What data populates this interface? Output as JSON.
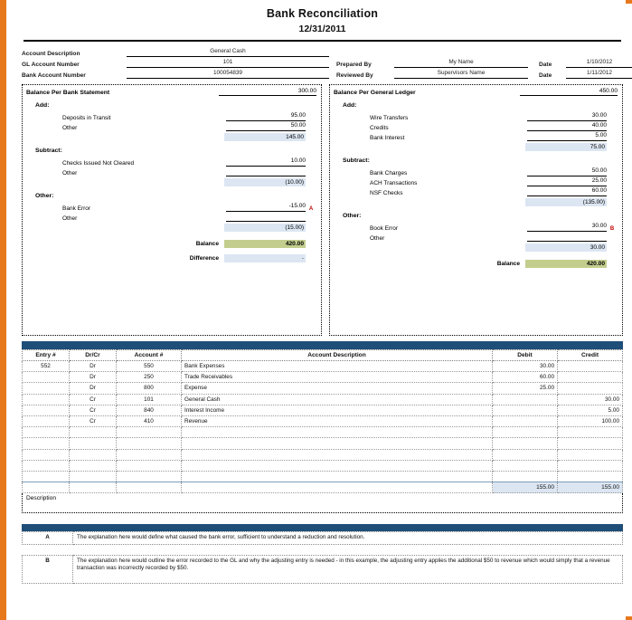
{
  "document": {
    "title": "Bank Reconciliation",
    "date": "12/31/2011"
  },
  "header": {
    "account_description_label": "Account Description",
    "account_description_value": "General Cash",
    "gl_account_number_label": "GL Account Number",
    "gl_account_number_value": "101",
    "bank_account_number_label": "Bank Account Number",
    "bank_account_number_value": "100054839",
    "prepared_by_label": "Prepared By",
    "prepared_by_value": "My Name",
    "prepared_date_label": "Date",
    "prepared_date_value": "1/10/2012",
    "reviewed_by_label": "Reviewed By",
    "reviewed_by_value": "Supervisors Name",
    "reviewed_date_label": "Date",
    "reviewed_date_value": "1/11/2012"
  },
  "bank_panel": {
    "heading": "Balance Per Bank Statement",
    "heading_value": "300.00",
    "add_label": "Add:",
    "add_items": [
      {
        "label": "Deposits in Transit",
        "value": "95.00"
      },
      {
        "label": "Other",
        "value": ""
      }
    ],
    "add_other_value": "50.00",
    "add_subtotal": "145.00",
    "subtract_label": "Subtract:",
    "subtract_items": [
      {
        "label": "Checks Issued Not Cleared",
        "value": "10.00"
      },
      {
        "label": "Other",
        "value": ""
      }
    ],
    "subtract_subtotal": "(10.00)",
    "other_label": "Other:",
    "other_items": [
      {
        "label": "Bank Error",
        "value": "-15.00",
        "mark": "A"
      },
      {
        "label": "Other",
        "value": "",
        "mark": ""
      }
    ],
    "other_subtotal": "(15.00)",
    "balance_label": "Balance",
    "balance_value": "420.00",
    "difference_label": "Difference",
    "difference_value": "-"
  },
  "ledger_panel": {
    "heading": "Balance Per General Ledger",
    "heading_value": "450.00",
    "add_label": "Add:",
    "add_items": [
      {
        "label": "Wire Transfers",
        "value": "30.00"
      },
      {
        "label": "Credits",
        "value": "40.00"
      },
      {
        "label": "Bank Interest",
        "value": "5.00"
      }
    ],
    "add_subtotal": "75.00",
    "subtract_label": "Subtract:",
    "subtract_items": [
      {
        "label": "Bank Charges",
        "value": "50.00"
      },
      {
        "label": "ACH Transactions",
        "value": "25.00"
      },
      {
        "label": "NSF Checks",
        "value": "60.00"
      }
    ],
    "subtract_subtotal": "(135.00)",
    "other_label": "Other:",
    "other_items": [
      {
        "label": "Book Error",
        "value": "30.00",
        "mark": "B"
      },
      {
        "label": "Other",
        "value": "",
        "mark": ""
      }
    ],
    "other_subtotal": "30.00",
    "balance_label": "Balance",
    "balance_value": "420.00"
  },
  "journal": {
    "columns": [
      "Entry #",
      "Dr/Cr",
      "Account #",
      "Account Description",
      "Debit",
      "Credit"
    ],
    "rows": [
      {
        "entry": "552",
        "drcr": "Dr",
        "account": "550",
        "description": "Bank Expenses",
        "debit": "30.00",
        "credit": ""
      },
      {
        "entry": "",
        "drcr": "Dr",
        "account": "250",
        "description": "Trade Receivables",
        "debit": "60.00",
        "credit": ""
      },
      {
        "entry": "",
        "drcr": "Dr",
        "account": "800",
        "description": "Expense",
        "debit": "25.00",
        "credit": ""
      },
      {
        "entry": "",
        "drcr": "Cr",
        "account": "101",
        "description": "General Cash",
        "debit": "",
        "credit": "30.00"
      },
      {
        "entry": "",
        "drcr": "Cr",
        "account": "840",
        "description": "Interest Income",
        "debit": "",
        "credit": "5.00"
      },
      {
        "entry": "",
        "drcr": "Cr",
        "account": "410",
        "description": "Revenue",
        "debit": "",
        "credit": "100.00"
      },
      {
        "entry": "",
        "drcr": "",
        "account": "",
        "description": "",
        "debit": "",
        "credit": ""
      },
      {
        "entry": "",
        "drcr": "",
        "account": "",
        "description": "",
        "debit": "",
        "credit": ""
      },
      {
        "entry": "",
        "drcr": "",
        "account": "",
        "description": "",
        "debit": "",
        "credit": ""
      },
      {
        "entry": "",
        "drcr": "",
        "account": "",
        "description": "",
        "debit": "",
        "credit": ""
      },
      {
        "entry": "",
        "drcr": "",
        "account": "",
        "description": "",
        "debit": "",
        "credit": ""
      }
    ],
    "total_debit": "155.00",
    "total_credit": "155.00",
    "description_label": "Description"
  },
  "footnotes": {
    "items": [
      {
        "key": "A",
        "text": "The explanation here would define what caused the bank error, sufficient to understand a reduction and resolution."
      },
      {
        "key": "B",
        "text": "The explanation here would outline the error recorded to the GL and why the adjusting entry is needed - in this example, the adjusting entry applies the additional $50 to revenue which would simply that a revenue transaction was incorrectly recorded by $50."
      }
    ]
  },
  "colors": {
    "border_accent": "#E8781C",
    "bar_blue": "#1F4E79",
    "subtotal_fill": "#DCE6F2",
    "balance_fill": "#C3CE8E",
    "mark_red": "#C00000"
  }
}
